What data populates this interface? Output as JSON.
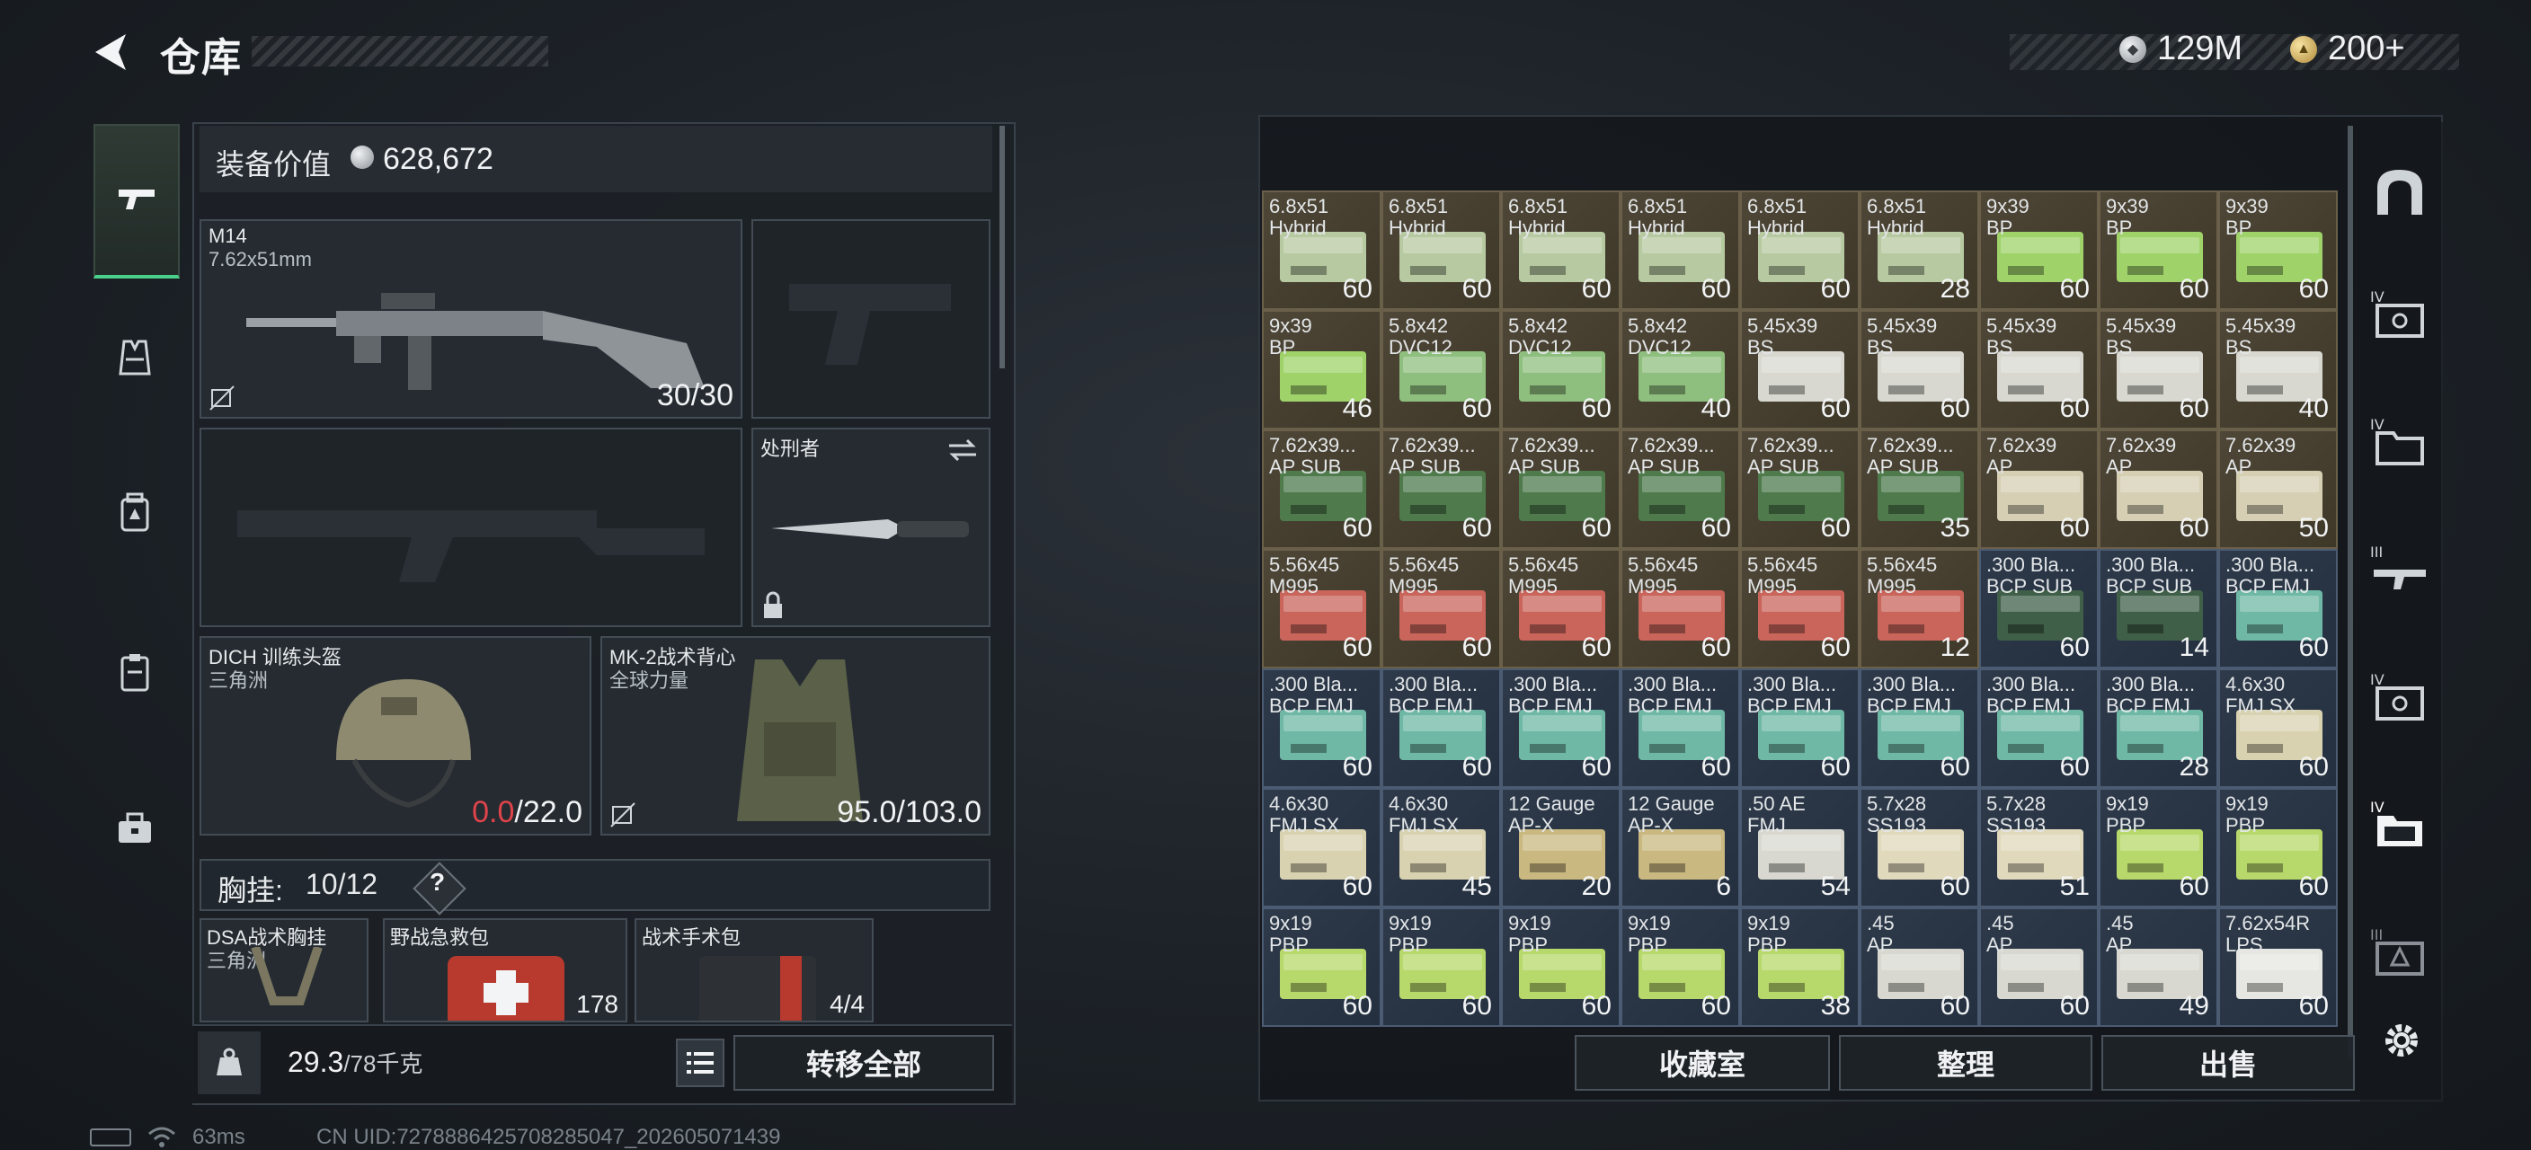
{
  "header": {
    "title": "仓库",
    "currencies": [
      {
        "icon": "silver-coin-icon",
        "value": "129M"
      },
      {
        "icon": "gold-coin-icon",
        "value": "200+"
      }
    ]
  },
  "left_nav": [
    {
      "icon": "pistol-icon",
      "active": true
    },
    {
      "icon": "vest-icon",
      "active": false
    },
    {
      "icon": "backpack-icon",
      "active": false
    },
    {
      "icon": "clipboard-icon",
      "active": false
    },
    {
      "icon": "toolbox-icon",
      "active": false
    }
  ],
  "loadout": {
    "value_label": "装备价值",
    "value": "628,672",
    "primary": {
      "name": "M14",
      "caliber": "7.62x51mm",
      "ammo": "30/30"
    },
    "melee": {
      "name": "处刑者"
    },
    "helmet": {
      "name": "DICH 训练头盔",
      "faction": "三角洲",
      "durability_current": "0.0",
      "durability_max": "/22.0"
    },
    "armor": {
      "name": "MK-2战术背心",
      "faction": "全球力量",
      "durability": "95.0/103.0"
    },
    "chest_rig": {
      "label": "胸挂:",
      "capacity": "10/12",
      "help": "?"
    },
    "rig_items": [
      {
        "name": "DSA战术胸挂",
        "sub": "三角洲",
        "qty": ""
      },
      {
        "name": "野战急救包",
        "sub": "",
        "qty": "178"
      },
      {
        "name": "战术手术包",
        "sub": "",
        "qty": "4/4"
      }
    ],
    "weight": "29.3",
    "weight_max": "/78千克",
    "transfer_all": "转移全部"
  },
  "inventory": [
    {
      "l1": "6.8x51",
      "l2": "Hybrid",
      "qty": "60",
      "color": "#b7c9a0",
      "bg": "gold"
    },
    {
      "l1": "6.8x51",
      "l2": "Hybrid",
      "qty": "60",
      "color": "#b7c9a0",
      "bg": "gold"
    },
    {
      "l1": "6.8x51",
      "l2": "Hybrid",
      "qty": "60",
      "color": "#b7c9a0",
      "bg": "gold"
    },
    {
      "l1": "6.8x51",
      "l2": "Hybrid",
      "qty": "60",
      "color": "#b7c9a0",
      "bg": "gold"
    },
    {
      "l1": "6.8x51",
      "l2": "Hybrid",
      "qty": "60",
      "color": "#b7c9a0",
      "bg": "gold"
    },
    {
      "l1": "6.8x51",
      "l2": "Hybrid",
      "qty": "28",
      "color": "#b7c9a0",
      "bg": "gold"
    },
    {
      "l1": "9x39",
      "l2": "BP",
      "qty": "60",
      "color": "#9fd36a",
      "bg": "gold"
    },
    {
      "l1": "9x39",
      "l2": "BP",
      "qty": "60",
      "color": "#9fd36a",
      "bg": "gold"
    },
    {
      "l1": "9x39",
      "l2": "BP",
      "qty": "60",
      "color": "#9fd36a",
      "bg": "gold"
    },
    {
      "l1": "9x39",
      "l2": "BP",
      "qty": "46",
      "color": "#9fd36a",
      "bg": "gold"
    },
    {
      "l1": "5.8x42",
      "l2": "DVC12",
      "qty": "60",
      "color": "#8fbf7e",
      "bg": "gold"
    },
    {
      "l1": "5.8x42",
      "l2": "DVC12",
      "qty": "60",
      "color": "#8fbf7e",
      "bg": "gold"
    },
    {
      "l1": "5.8x42",
      "l2": "DVC12",
      "qty": "40",
      "color": "#8fbf7e",
      "bg": "gold"
    },
    {
      "l1": "5.45x39",
      "l2": "BS",
      "qty": "60",
      "color": "#d8d8d0",
      "bg": "gold"
    },
    {
      "l1": "5.45x39",
      "l2": "BS",
      "qty": "60",
      "color": "#d8d8d0",
      "bg": "gold"
    },
    {
      "l1": "5.45x39",
      "l2": "BS",
      "qty": "60",
      "color": "#d8d8d0",
      "bg": "gold"
    },
    {
      "l1": "5.45x39",
      "l2": "BS",
      "qty": "60",
      "color": "#d8d8d0",
      "bg": "gold"
    },
    {
      "l1": "5.45x39",
      "l2": "BS",
      "qty": "40",
      "color": "#d8d8d0",
      "bg": "gold"
    },
    {
      "l1": "7.62x39...",
      "l2": "AP SUB",
      "qty": "60",
      "color": "#4e7a4c",
      "bg": "gold"
    },
    {
      "l1": "7.62x39...",
      "l2": "AP SUB",
      "qty": "60",
      "color": "#4e7a4c",
      "bg": "gold"
    },
    {
      "l1": "7.62x39...",
      "l2": "AP SUB",
      "qty": "60",
      "color": "#4e7a4c",
      "bg": "gold"
    },
    {
      "l1": "7.62x39...",
      "l2": "AP SUB",
      "qty": "60",
      "color": "#4e7a4c",
      "bg": "gold"
    },
    {
      "l1": "7.62x39...",
      "l2": "AP SUB",
      "qty": "60",
      "color": "#4e7a4c",
      "bg": "gold"
    },
    {
      "l1": "7.62x39...",
      "l2": "AP SUB",
      "qty": "35",
      "color": "#4e7a4c",
      "bg": "gold"
    },
    {
      "l1": "7.62x39",
      "l2": "AP",
      "qty": "60",
      "color": "#d6cfb4",
      "bg": "gold"
    },
    {
      "l1": "7.62x39",
      "l2": "AP",
      "qty": "60",
      "color": "#d6cfb4",
      "bg": "gold"
    },
    {
      "l1": "7.62x39",
      "l2": "AP",
      "qty": "50",
      "color": "#d6cfb4",
      "bg": "gold"
    },
    {
      "l1": "5.56x45",
      "l2": "M995",
      "qty": "60",
      "color": "#c9655b",
      "bg": "gold"
    },
    {
      "l1": "5.56x45",
      "l2": "M995",
      "qty": "60",
      "color": "#c9655b",
      "bg": "gold"
    },
    {
      "l1": "5.56x45",
      "l2": "M995",
      "qty": "60",
      "color": "#c9655b",
      "bg": "gold"
    },
    {
      "l1": "5.56x45",
      "l2": "M995",
      "qty": "60",
      "color": "#c9655b",
      "bg": "gold"
    },
    {
      "l1": "5.56x45",
      "l2": "M995",
      "qty": "60",
      "color": "#c9655b",
      "bg": "gold"
    },
    {
      "l1": "5.56x45",
      "l2": "M995",
      "qty": "12",
      "color": "#c9655b",
      "bg": "gold"
    },
    {
      "l1": ".300 Bla...",
      "l2": "BCP SUB",
      "qty": "60",
      "color": "#3f5f48",
      "bg": "blue"
    },
    {
      "l1": ".300 Bla...",
      "l2": "BCP SUB",
      "qty": "14",
      "color": "#3f5f48",
      "bg": "blue"
    },
    {
      "l1": ".300 Bla...",
      "l2": "BCP FMJ",
      "qty": "60",
      "color": "#6fb8a6",
      "bg": "blue"
    },
    {
      "l1": ".300 Bla...",
      "l2": "BCP FMJ",
      "qty": "60",
      "color": "#6fb8a6",
      "bg": "blue"
    },
    {
      "l1": ".300 Bla...",
      "l2": "BCP FMJ",
      "qty": "60",
      "color": "#6fb8a6",
      "bg": "blue"
    },
    {
      "l1": ".300 Bla...",
      "l2": "BCP FMJ",
      "qty": "60",
      "color": "#6fb8a6",
      "bg": "blue"
    },
    {
      "l1": ".300 Bla...",
      "l2": "BCP FMJ",
      "qty": "60",
      "color": "#6fb8a6",
      "bg": "blue"
    },
    {
      "l1": ".300 Bla...",
      "l2": "BCP FMJ",
      "qty": "60",
      "color": "#6fb8a6",
      "bg": "blue"
    },
    {
      "l1": ".300 Bla...",
      "l2": "BCP FMJ",
      "qty": "60",
      "color": "#6fb8a6",
      "bg": "blue"
    },
    {
      "l1": ".300 Bla...",
      "l2": "BCP FMJ",
      "qty": "60",
      "color": "#6fb8a6",
      "bg": "blue"
    },
    {
      "l1": ".300 Bla...",
      "l2": "BCP FMJ",
      "qty": "28",
      "color": "#6fb8a6",
      "bg": "blue"
    },
    {
      "l1": "4.6x30",
      "l2": "FMJ SX",
      "qty": "60",
      "color": "#d9d2b0",
      "bg": "blue"
    },
    {
      "l1": "4.6x30",
      "l2": "FMJ SX",
      "qty": "60",
      "color": "#d9d2b0",
      "bg": "blue"
    },
    {
      "l1": "4.6x30",
      "l2": "FMJ SX",
      "qty": "45",
      "color": "#d9d2b0",
      "bg": "blue"
    },
    {
      "l1": "12 Gauge",
      "l2": "AP-X",
      "qty": "20",
      "color": "#c9b880",
      "bg": "blue"
    },
    {
      "l1": "12 Gauge",
      "l2": "AP-X",
      "qty": "6",
      "color": "#c9b880",
      "bg": "blue"
    },
    {
      "l1": ".50 AE",
      "l2": "FMJ",
      "qty": "54",
      "color": "#d8d8d0",
      "bg": "blue"
    },
    {
      "l1": "5.7x28",
      "l2": "SS193",
      "qty": "60",
      "color": "#e0d9bc",
      "bg": "blue"
    },
    {
      "l1": "5.7x28",
      "l2": "SS193",
      "qty": "51",
      "color": "#e0d9bc",
      "bg": "blue"
    },
    {
      "l1": "9x19",
      "l2": "PBP",
      "qty": "60",
      "color": "#b7d86a",
      "bg": "blue"
    },
    {
      "l1": "9x19",
      "l2": "PBP",
      "qty": "60",
      "color": "#b7d86a",
      "bg": "blue"
    },
    {
      "l1": "9x19",
      "l2": "PBP",
      "qty": "60",
      "color": "#b7d86a",
      "bg": "blue"
    },
    {
      "l1": "9x19",
      "l2": "PBP",
      "qty": "60",
      "color": "#b7d86a",
      "bg": "blue"
    },
    {
      "l1": "9x19",
      "l2": "PBP",
      "qty": "60",
      "color": "#b7d86a",
      "bg": "blue"
    },
    {
      "l1": "9x19",
      "l2": "PBP",
      "qty": "60",
      "color": "#b7d86a",
      "bg": "blue"
    },
    {
      "l1": "9x19",
      "l2": "PBP",
      "qty": "38",
      "color": "#b7d86a",
      "bg": "blue"
    },
    {
      "l1": ".45",
      "l2": "AP",
      "qty": "60",
      "color": "#d8d8d0",
      "bg": "blue"
    },
    {
      "l1": ".45",
      "l2": "AP",
      "qty": "60",
      "color": "#d8d8d0",
      "bg": "blue"
    },
    {
      "l1": ".45",
      "l2": "AP",
      "qty": "49",
      "color": "#d8d8d0",
      "bg": "blue"
    },
    {
      "l1": "7.62x54R",
      "l2": "LPS",
      "qty": "60",
      "color": "#e6e6e2",
      "bg": "blue"
    }
  ],
  "right_nav": [
    {
      "icon": "arch-icon"
    },
    {
      "icon": "secure-box-iv-icon"
    },
    {
      "icon": "folder-iv-icon"
    },
    {
      "icon": "rifle-iii-icon"
    },
    {
      "icon": "secure-box-iv-icon-2"
    },
    {
      "icon": "folder-iv-icon-active"
    },
    {
      "icon": "box-iii-icon"
    }
  ],
  "bottom_buttons": {
    "collection": "收藏室",
    "sort": "整理",
    "sell": "出售"
  },
  "status": {
    "ping": "63ms",
    "uid": "CN UID:7278886425708285047_202605071439"
  }
}
